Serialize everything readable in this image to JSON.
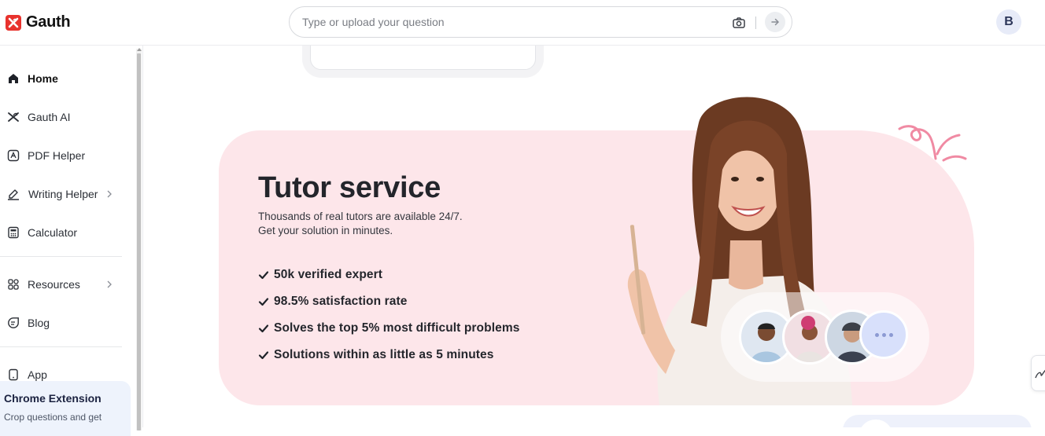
{
  "header": {
    "logo_text": "Gauth",
    "search_placeholder": "Type or upload your question",
    "avatar_initial": "B"
  },
  "sidebar": {
    "items": [
      {
        "label": "Home",
        "icon": "home-icon"
      },
      {
        "label": "Gauth AI",
        "icon": "gauth-ai-icon"
      },
      {
        "label": "PDF Helper",
        "icon": "pdf-icon"
      },
      {
        "label": "Writing Helper",
        "icon": "pen-icon"
      },
      {
        "label": "Calculator",
        "icon": "calculator-icon"
      },
      {
        "label": "Resources",
        "icon": "grid-icon"
      },
      {
        "label": "Blog",
        "icon": "blog-icon"
      },
      {
        "label": "App",
        "icon": "phone-icon"
      }
    ],
    "extension": {
      "title": "Chrome Extension",
      "subtitle": "Crop questions and get"
    }
  },
  "banner": {
    "title": "Tutor service",
    "subtitle_line1": "Thousands of real tutors are available 24/7.",
    "subtitle_line2": "Get your solution in minutes.",
    "features": [
      "50k verified expert",
      "98.5% satisfaction rate",
      "Solves the top 5% most difficult problems",
      "Solutions within as little as 5 minutes"
    ]
  },
  "colors": {
    "brand": "#e8322d",
    "banner_bg": "#fde6ea",
    "accent_squiggle": "#f08aa3"
  }
}
